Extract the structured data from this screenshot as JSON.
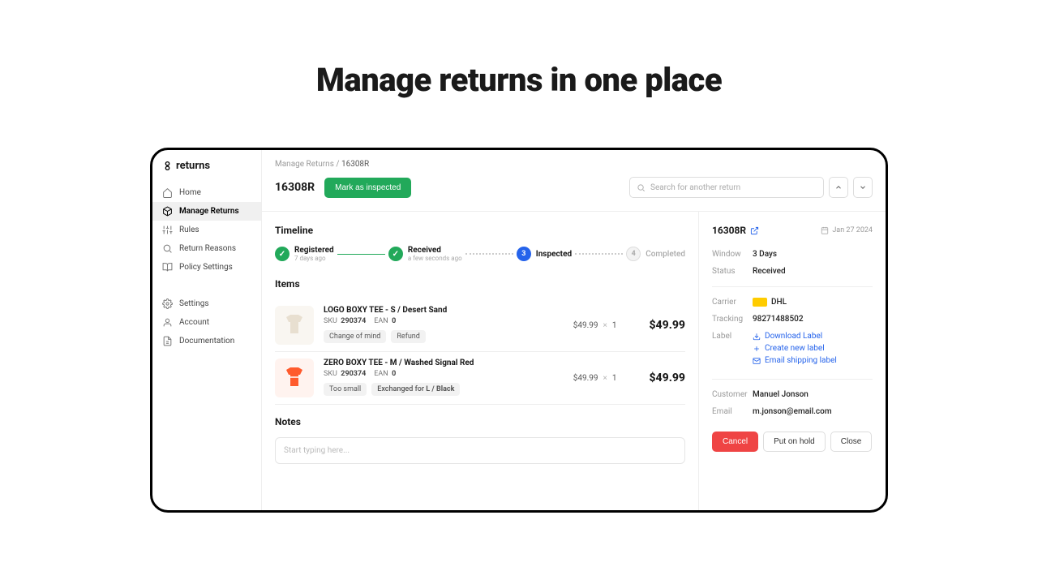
{
  "hero": "Manage returns in one place",
  "logo": "returns",
  "nav": {
    "home": "Home",
    "manage": "Manage Returns",
    "rules": "Rules",
    "reasons": "Return Reasons",
    "policy": "Policy Settings",
    "settings": "Settings",
    "account": "Account",
    "docs": "Documentation"
  },
  "breadcrumb": {
    "root": "Manage Returns /",
    "current": "16308R"
  },
  "header": {
    "id": "16308R",
    "mark_btn": "Mark as inspected",
    "search_ph": "Search for another return"
  },
  "timeline": {
    "title": "Timeline",
    "registered": {
      "label": "Registered",
      "sub": "7 days ago"
    },
    "received": {
      "label": "Received",
      "sub": "a few seconds ago"
    },
    "inspected": {
      "label": "Inspected",
      "num": "3"
    },
    "completed": {
      "label": "Completed",
      "num": "4"
    }
  },
  "items": {
    "title": "Items",
    "i0": {
      "name": "LOGO BOXY TEE - S / Desert Sand",
      "sku_l": "SKU",
      "sku": "290374",
      "ean_l": "EAN",
      "ean": "0",
      "tag1": "Change of mind",
      "tag2": "Refund",
      "unit": "$49.99",
      "x": "×",
      "qty": "1",
      "total": "$49.99",
      "color": "#e8dfd0"
    },
    "i1": {
      "name": "ZERO BOXY TEE - M / Washed Signal Red",
      "sku_l": "SKU",
      "sku": "290374",
      "ean_l": "EAN",
      "ean": "0",
      "tag1": "Too small",
      "tag2a": "Exchanged for ",
      "tag2b": "L / Black",
      "unit": "$49.99",
      "x": "×",
      "qty": "1",
      "total": "$49.99",
      "color": "#ff5a2c"
    }
  },
  "notes": {
    "title": "Notes",
    "ph": "Start typing here..."
  },
  "details": {
    "id": "16308R",
    "date": "Jan 27 2024",
    "window_l": "Window",
    "window": "3 Days",
    "status_l": "Status",
    "status": "Received",
    "carrier_l": "Carrier",
    "carrier": "DHL",
    "tracking_l": "Tracking",
    "tracking": "98271488502",
    "label_l": "Label",
    "dl": "Download Label",
    "create": "Create new label",
    "email": "Email shipping label",
    "customer_l": "Customer",
    "customer": "Manuel Jonson",
    "email_l": "Email",
    "email_v": "m.jonson@email.com",
    "cancel": "Cancel",
    "hold": "Put on hold",
    "close": "Close"
  }
}
